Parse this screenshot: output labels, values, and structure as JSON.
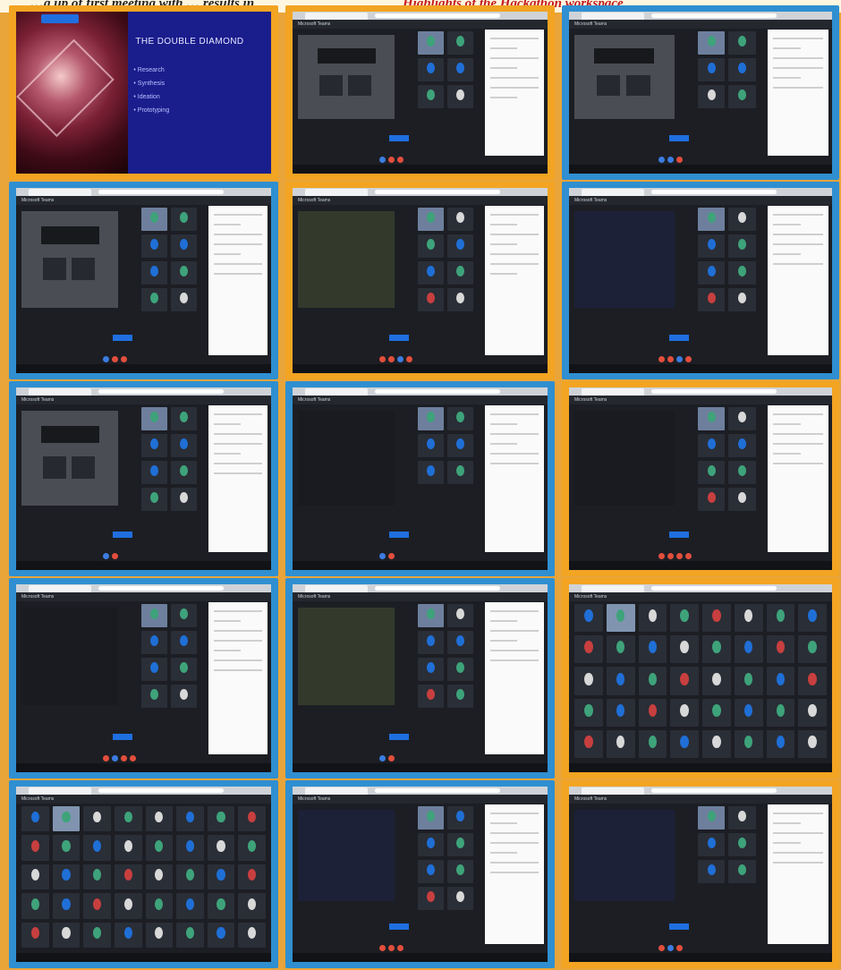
{
  "caption": {
    "line_black": "…g up of first meeting with … results in",
    "line_red": "Highlights of the Hackathon workspace"
  },
  "slide": {
    "title": "THE DOUBLE DIAMOND",
    "bullets": [
      "Research",
      "Synthesis",
      "Ideation",
      "Prototyping"
    ]
  },
  "meeting": {
    "window_title": "Microsoft Teams"
  },
  "colors": {
    "frame_blue": "#2f8fd1",
    "frame_orange": "#f2a422",
    "slide_navy": "#1a1d8c",
    "teams_dark": "#1c1e24",
    "accent_blue": "#1f6fe0",
    "control_red": "#e24e3c"
  }
}
